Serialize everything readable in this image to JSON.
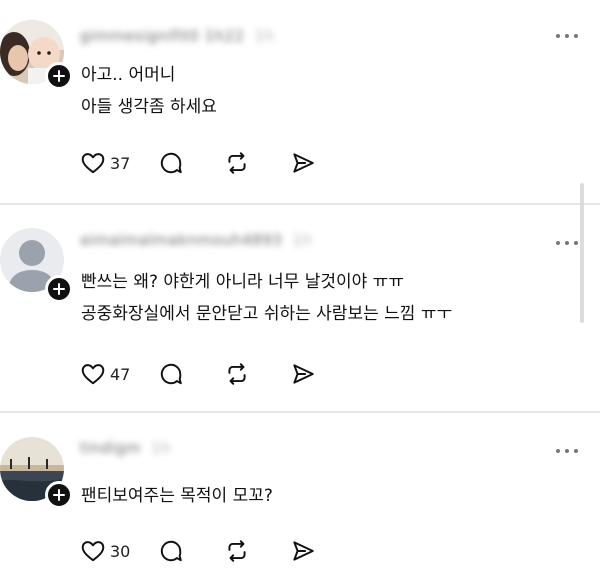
{
  "posts": [
    {
      "username": "gimmesignifit0 1h22",
      "time": "1h",
      "lines": [
        "아고.. 어머니",
        "아들 생각좀 하세요"
      ],
      "likes": "37"
    },
    {
      "username": "aimalmalmaknmouh4893",
      "time": "1h",
      "lines": [
        "빤쓰는 왜? 야한게 아니라 너무 날것이야 ㅠㅠ",
        "공중화장실에서 문안닫고 쉬하는 사람보는 느낌 ㅠㅜ"
      ],
      "likes": "47"
    },
    {
      "username": "tindigm",
      "time": "1h",
      "lines": [
        "팬티보여주는 목적이 모꼬?"
      ],
      "likes": "30"
    }
  ],
  "colors": {
    "text": "#111111",
    "muted": "#6b6b6b",
    "divider": "#e6e6e6",
    "badge": "#111111"
  },
  "icons": [
    "heart-icon",
    "comment-icon",
    "repost-icon",
    "share-icon",
    "more-icon",
    "plus-icon"
  ]
}
